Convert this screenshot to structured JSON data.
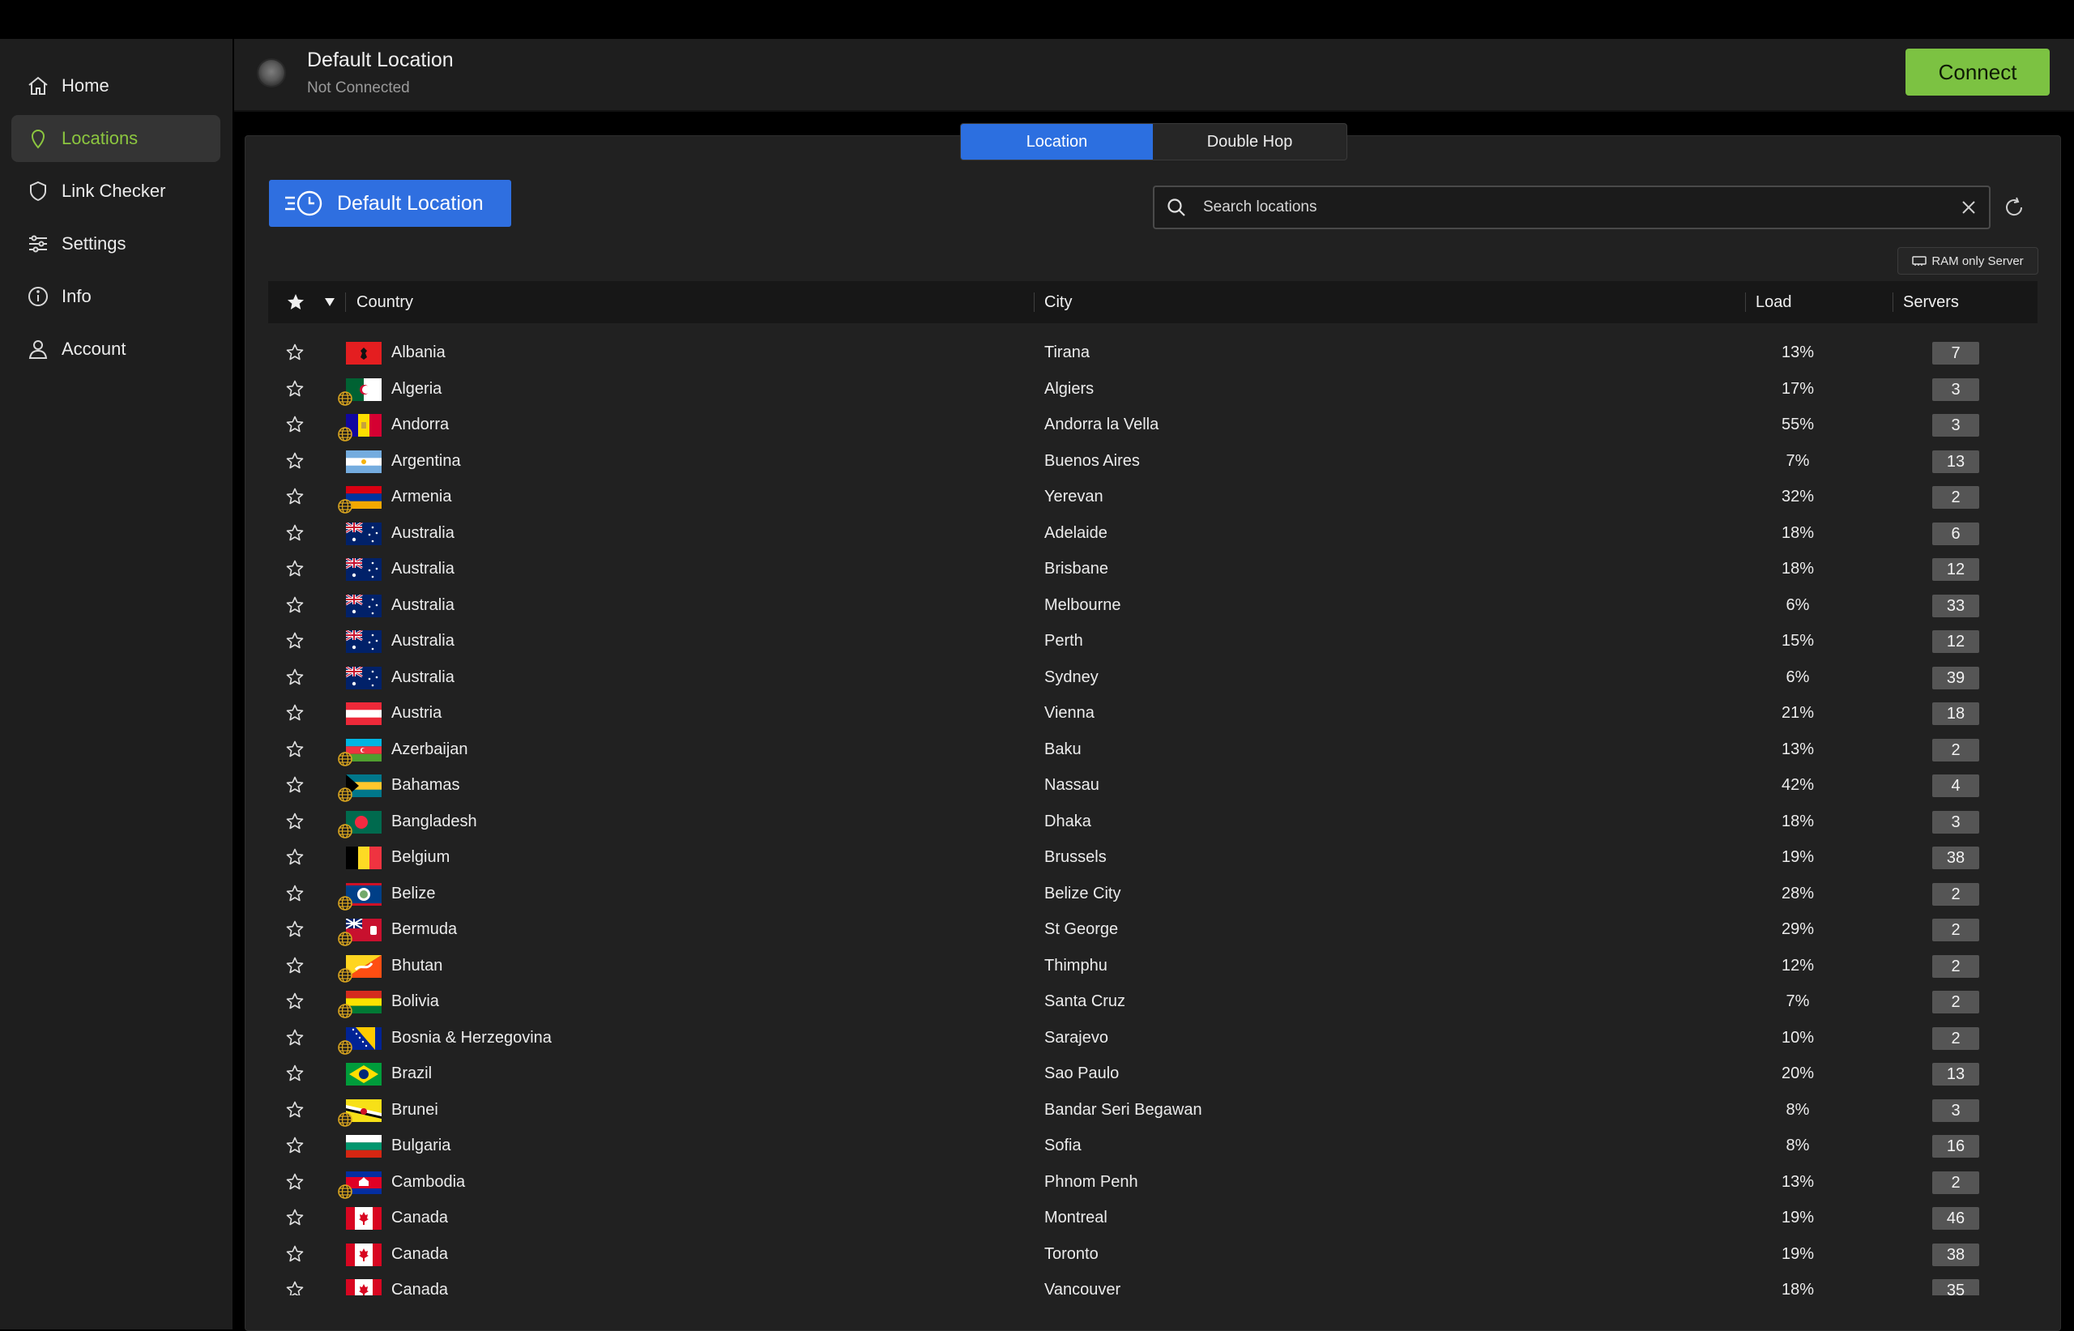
{
  "sidebar": {
    "items": [
      {
        "label": "Home",
        "icon": "home-icon"
      },
      {
        "label": "Locations",
        "icon": "location-pin-icon",
        "active": true
      },
      {
        "label": "Link Checker",
        "icon": "shield-icon"
      },
      {
        "label": "Settings",
        "icon": "sliders-icon"
      },
      {
        "label": "Info",
        "icon": "info-icon"
      },
      {
        "label": "Account",
        "icon": "person-icon"
      }
    ]
  },
  "header": {
    "title": "Default Location",
    "subtitle": "Not Connected",
    "connect_label": "Connect"
  },
  "tabs": [
    {
      "label": "Location",
      "active": true
    },
    {
      "label": "Double Hop",
      "active": false
    }
  ],
  "default_location_button": "Default Location",
  "search": {
    "placeholder": "Search locations",
    "value": ""
  },
  "ram_only_label": "RAM only Server",
  "table": {
    "columns": {
      "country": "Country",
      "city": "City",
      "load": "Load",
      "servers": "Servers"
    },
    "rows": [
      {
        "country": "Albania",
        "city": "Tirana",
        "load": "13%",
        "servers": "7",
        "virtual": false,
        "flag": "albania"
      },
      {
        "country": "Algeria",
        "city": "Algiers",
        "load": "17%",
        "servers": "3",
        "virtual": true,
        "flag": "algeria"
      },
      {
        "country": "Andorra",
        "city": "Andorra la Vella",
        "load": "55%",
        "servers": "3",
        "virtual": true,
        "flag": "andorra"
      },
      {
        "country": "Argentina",
        "city": "Buenos Aires",
        "load": "7%",
        "servers": "13",
        "virtual": false,
        "flag": "argentina"
      },
      {
        "country": "Armenia",
        "city": "Yerevan",
        "load": "32%",
        "servers": "2",
        "virtual": true,
        "flag": "armenia"
      },
      {
        "country": "Australia",
        "city": "Adelaide",
        "load": "18%",
        "servers": "6",
        "virtual": false,
        "flag": "australia"
      },
      {
        "country": "Australia",
        "city": "Brisbane",
        "load": "18%",
        "servers": "12",
        "virtual": false,
        "flag": "australia"
      },
      {
        "country": "Australia",
        "city": "Melbourne",
        "load": "6%",
        "servers": "33",
        "virtual": false,
        "flag": "australia"
      },
      {
        "country": "Australia",
        "city": "Perth",
        "load": "15%",
        "servers": "12",
        "virtual": false,
        "flag": "australia"
      },
      {
        "country": "Australia",
        "city": "Sydney",
        "load": "6%",
        "servers": "39",
        "virtual": false,
        "flag": "australia"
      },
      {
        "country": "Austria",
        "city": "Vienna",
        "load": "21%",
        "servers": "18",
        "virtual": false,
        "flag": "austria"
      },
      {
        "country": "Azerbaijan",
        "city": "Baku",
        "load": "13%",
        "servers": "2",
        "virtual": true,
        "flag": "azerbaijan"
      },
      {
        "country": "Bahamas",
        "city": "Nassau",
        "load": "42%",
        "servers": "4",
        "virtual": true,
        "flag": "bahamas"
      },
      {
        "country": "Bangladesh",
        "city": "Dhaka",
        "load": "18%",
        "servers": "3",
        "virtual": true,
        "flag": "bangladesh"
      },
      {
        "country": "Belgium",
        "city": "Brussels",
        "load": "19%",
        "servers": "38",
        "virtual": false,
        "flag": "belgium"
      },
      {
        "country": "Belize",
        "city": "Belize City",
        "load": "28%",
        "servers": "2",
        "virtual": true,
        "flag": "belize"
      },
      {
        "country": "Bermuda",
        "city": "St George",
        "load": "29%",
        "servers": "2",
        "virtual": true,
        "flag": "bermuda"
      },
      {
        "country": "Bhutan",
        "city": "Thimphu",
        "load": "12%",
        "servers": "2",
        "virtual": true,
        "flag": "bhutan"
      },
      {
        "country": "Bolivia",
        "city": "Santa Cruz",
        "load": "7%",
        "servers": "2",
        "virtual": true,
        "flag": "bolivia"
      },
      {
        "country": "Bosnia & Herzegovina",
        "city": "Sarajevo",
        "load": "10%",
        "servers": "2",
        "virtual": true,
        "flag": "bosnia"
      },
      {
        "country": "Brazil",
        "city": "Sao Paulo",
        "load": "20%",
        "servers": "13",
        "virtual": false,
        "flag": "brazil"
      },
      {
        "country": "Brunei",
        "city": "Bandar Seri Begawan",
        "load": "8%",
        "servers": "3",
        "virtual": true,
        "flag": "brunei"
      },
      {
        "country": "Bulgaria",
        "city": "Sofia",
        "load": "8%",
        "servers": "16",
        "virtual": false,
        "flag": "bulgaria"
      },
      {
        "country": "Cambodia",
        "city": "Phnom Penh",
        "load": "13%",
        "servers": "2",
        "virtual": true,
        "flag": "cambodia"
      },
      {
        "country": "Canada",
        "city": "Montreal",
        "load": "19%",
        "servers": "46",
        "virtual": false,
        "flag": "canada"
      },
      {
        "country": "Canada",
        "city": "Toronto",
        "load": "19%",
        "servers": "38",
        "virtual": false,
        "flag": "canada"
      },
      {
        "country": "Canada",
        "city": "Vancouver",
        "load": "18%",
        "servers": "35",
        "virtual": false,
        "flag": "canada"
      }
    ]
  },
  "colors": {
    "accent_green": "#7cc242",
    "active_nav_text": "#8cc63f",
    "primary_blue": "#2f6fe0",
    "globe_gold": "#d9a520"
  }
}
